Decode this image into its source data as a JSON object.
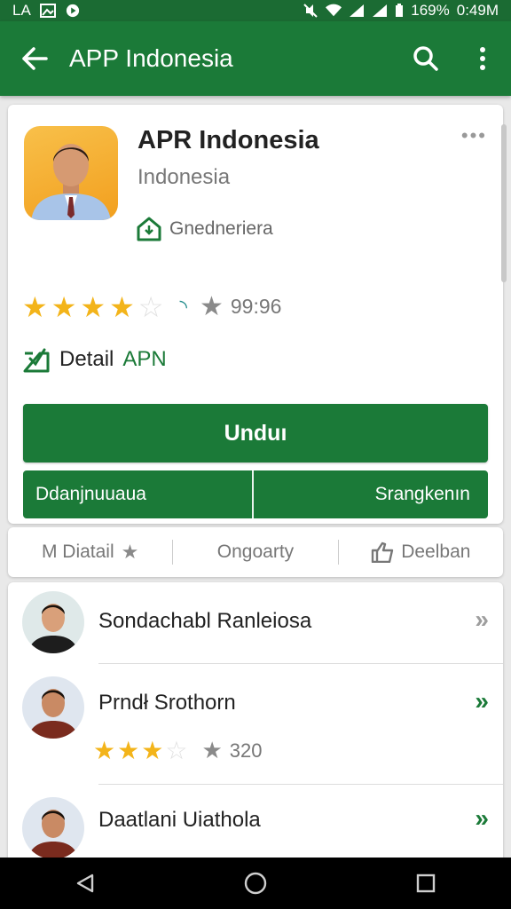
{
  "status_bar": {
    "left_text": "LA",
    "battery": "169%",
    "time": "0:49M"
  },
  "app_bar": {
    "title": "APP Indonesia",
    "back_icon": "arrow-left-icon",
    "search_icon": "search-icon",
    "menu_icon": "more-vert-icon"
  },
  "app": {
    "name": "APR Indonesia",
    "developer": "Indonesia",
    "category": "Gnedneriera",
    "rating_stars": 3.5,
    "review_count": "99:96",
    "detail_label": "Detail",
    "detail_accent": "APN",
    "install_label": "Unduı",
    "secondary_left": "Ddanjnuuaua",
    "secondary_right": "Srangkenın"
  },
  "tabs": [
    {
      "label": "M Diatail",
      "icon": "star-icon"
    },
    {
      "label": "Ongoarty",
      "icon": ""
    },
    {
      "label": "Deelban",
      "icon": "thumbs-up-icon"
    }
  ],
  "list": [
    {
      "title": "Sondachabl Ranleiosa",
      "chevron_color": "#9e9e9e"
    },
    {
      "title": "Prndł Srothorn",
      "rating_stars": 2.5,
      "review_count": "320",
      "chevron_color": "#1b7a38"
    },
    {
      "title": "Daatlani Uiathola",
      "chevron_color": "#1b7a38"
    }
  ],
  "colors": {
    "primary": "#1b7a38",
    "star": "#f3b41a"
  }
}
